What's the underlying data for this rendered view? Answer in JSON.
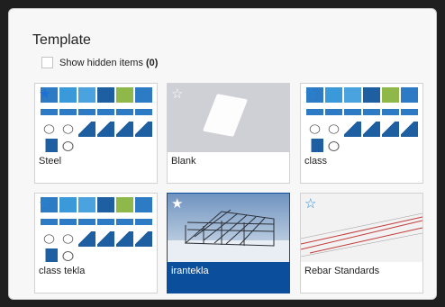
{
  "header": {
    "title": "Template"
  },
  "options": {
    "show_hidden_label": "Show hidden items",
    "show_hidden_count": "(0)"
  },
  "templates": [
    {
      "name": "Steel",
      "icon": "star-filled-icon"
    },
    {
      "name": "Blank",
      "icon": "star-outline-icon"
    },
    {
      "name": "class",
      "icon": "star-outline-icon"
    },
    {
      "name": "class tekla",
      "icon": "star-outline-icon"
    },
    {
      "name": "irantekla",
      "icon": "star-filled-icon",
      "selected": true
    },
    {
      "name": "Rebar Standards",
      "icon": "star-outline-icon"
    }
  ],
  "colors": {
    "selection": "#0b4f9c",
    "star": "#1f6fd6"
  }
}
